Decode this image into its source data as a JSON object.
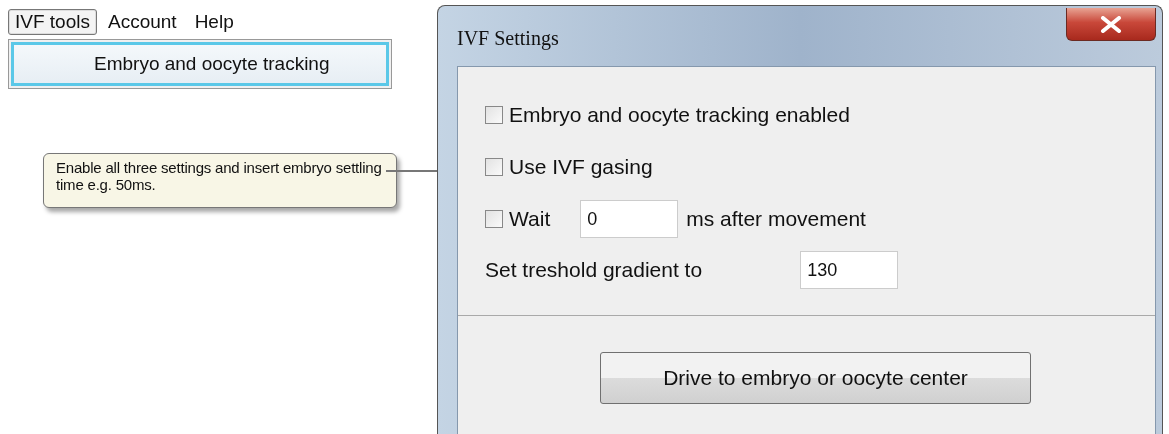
{
  "menu_bar": {
    "items": [
      {
        "label": "IVF tools",
        "selected": true
      },
      {
        "label": "Account",
        "selected": false
      },
      {
        "label": "Help",
        "selected": false
      }
    ]
  },
  "dropdown": {
    "items": [
      {
        "label": "Embryo and oocyte tracking",
        "selected": true
      }
    ]
  },
  "callout": {
    "text": "Enable all three settings and insert embryo settling time e.g. 50ms."
  },
  "dialog": {
    "title": "IVF Settings",
    "rows": [
      {
        "kind": "checkbox",
        "label": "Embryo and oocyte tracking enabled",
        "checked": false
      },
      {
        "kind": "checkbox",
        "label": "Use IVF gasing",
        "checked": false
      },
      {
        "kind": "checkbox_field",
        "label": "Wait",
        "value": "0",
        "suffix": "ms after movement",
        "checked": false
      },
      {
        "kind": "field",
        "label": "Set treshold gradient to",
        "value": "130"
      }
    ],
    "button": "Drive to embryo or oocyte center"
  }
}
